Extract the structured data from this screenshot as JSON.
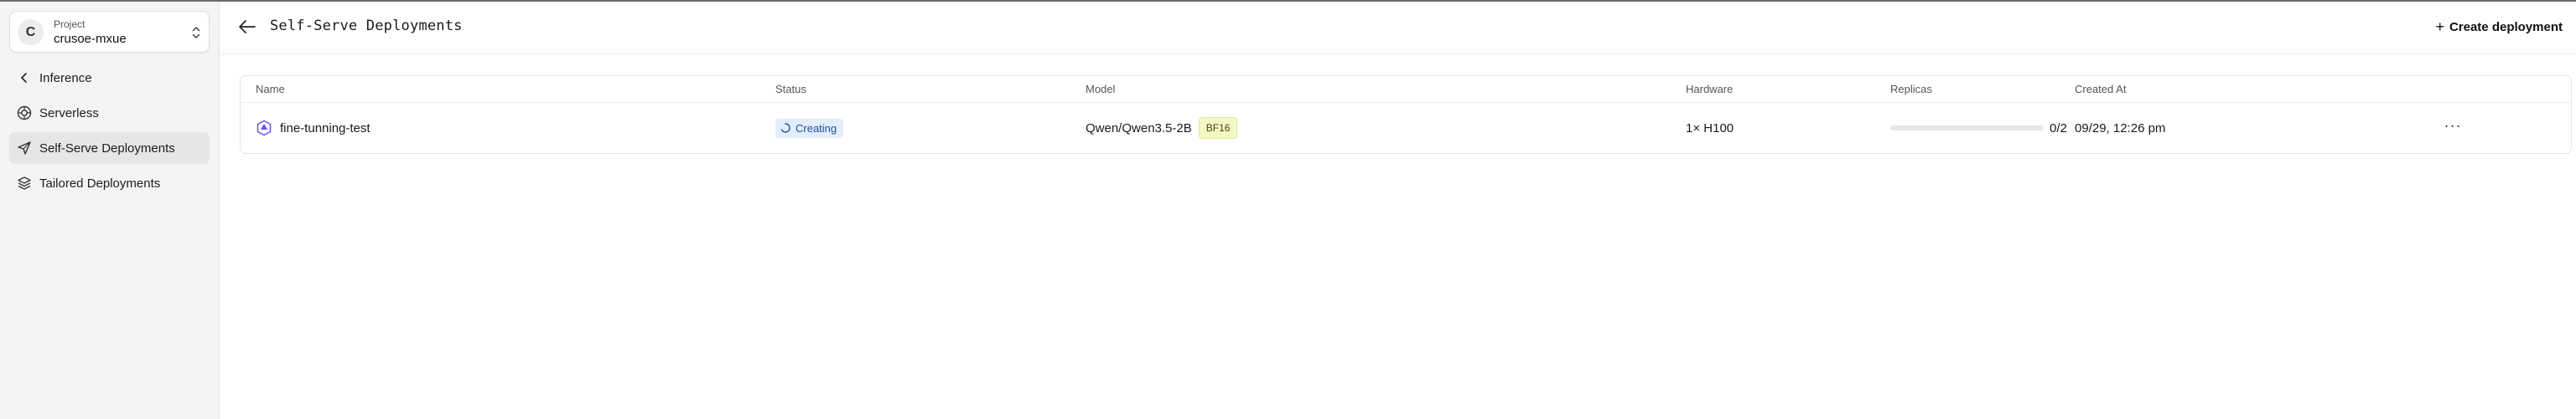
{
  "sidebar": {
    "project": {
      "label": "Project",
      "name": "crusoe-mxue",
      "initial": "C"
    },
    "items": [
      {
        "label": "Inference",
        "icon": "chevron-left-icon",
        "active": false
      },
      {
        "label": "Serverless",
        "icon": "serverless-icon",
        "active": false
      },
      {
        "label": "Self-Serve Deployments",
        "icon": "rocket-icon",
        "active": true
      },
      {
        "label": "Tailored Deployments",
        "icon": "layers-icon",
        "active": false
      }
    ]
  },
  "header": {
    "title": "Self-Serve Deployments",
    "create_label": "Create deployment"
  },
  "table": {
    "columns": [
      "Name",
      "Status",
      "Model",
      "Hardware",
      "Replicas",
      "Created At"
    ],
    "rows": [
      {
        "name": "fine-tunning-test",
        "status": "Creating",
        "model": "Qwen/Qwen3.5-2B",
        "precision": "BF16",
        "hardware": "1× H100",
        "replicas_ready": 0,
        "replicas_total": 2,
        "replicas_text": "0/2",
        "created_at": "09/29, 12:26 pm",
        "more": "···"
      }
    ]
  },
  "colors": {
    "status_bg": "#e3eefc",
    "status_text": "#1d4e9e",
    "precision_bg": "#f3f7c2",
    "progress_fill": "#7a8cff"
  }
}
